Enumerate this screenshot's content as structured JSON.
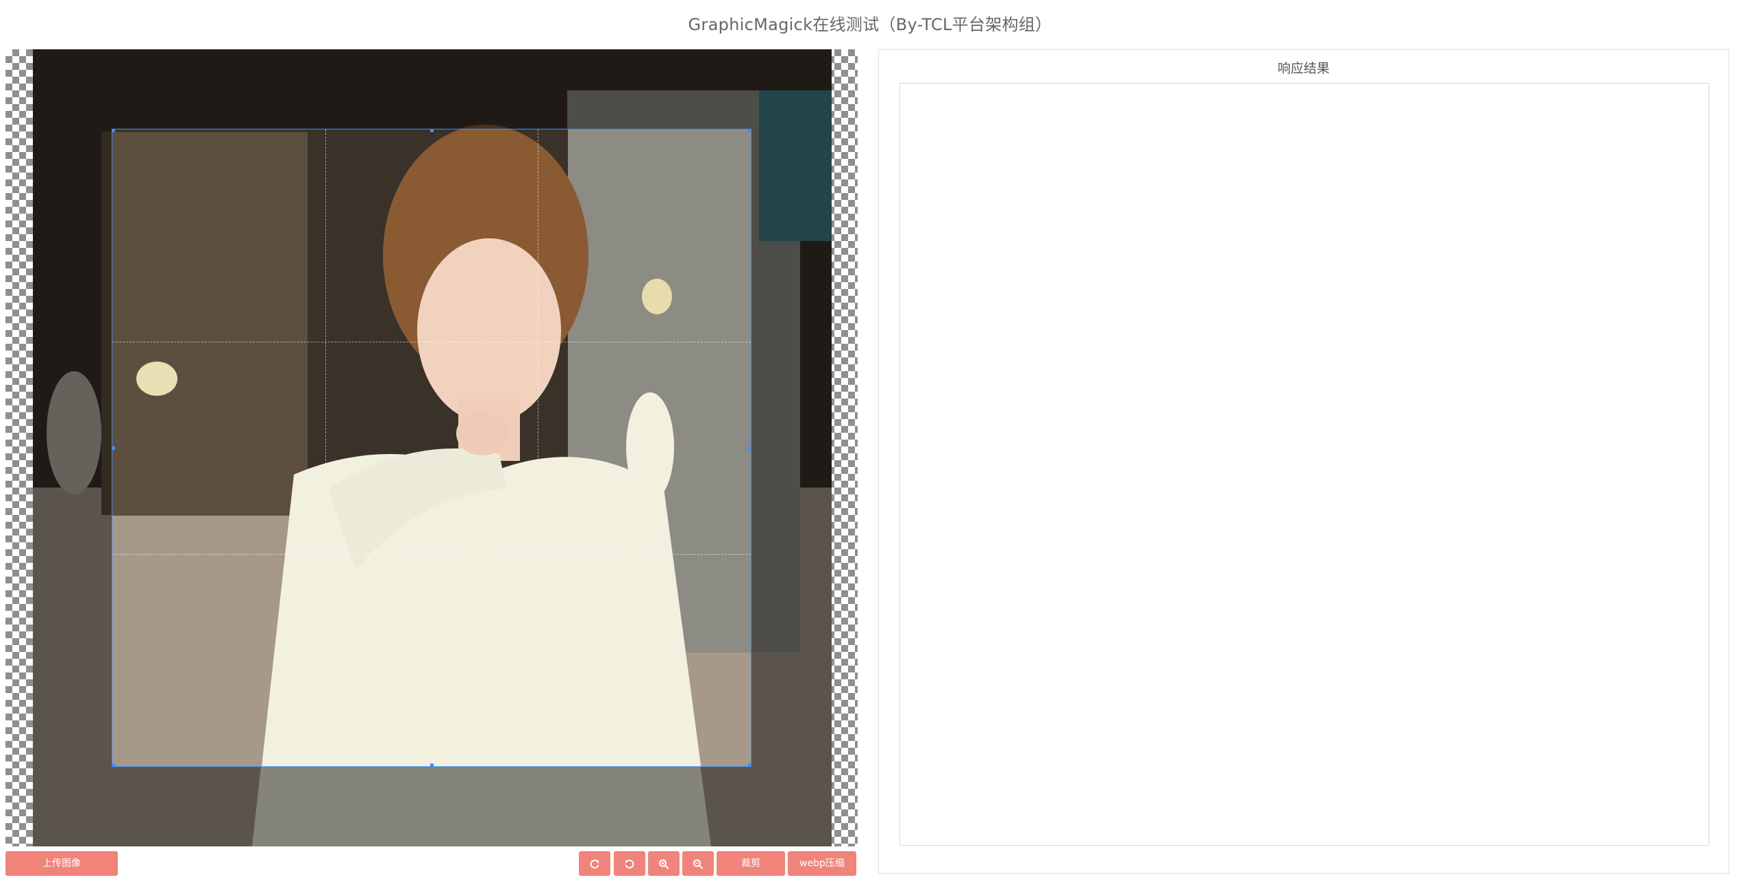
{
  "page": {
    "title": "GraphicMagick在线测试（By-TCL平台架构组）"
  },
  "toolbar": {
    "upload_label": "上传图像",
    "rotate_right_icon": "rotate-clockwise-icon",
    "rotate_left_icon": "rotate-counterclockwise-icon",
    "zoom_in_icon": "zoom-in-icon",
    "zoom_out_icon": "zoom-out-icon",
    "crop_label": "裁剪",
    "webp_label": "webp压缩"
  },
  "response": {
    "title": "响应结果",
    "content": ""
  },
  "colors": {
    "accent": "#f0837a",
    "crop_border": "#3f8df0"
  }
}
